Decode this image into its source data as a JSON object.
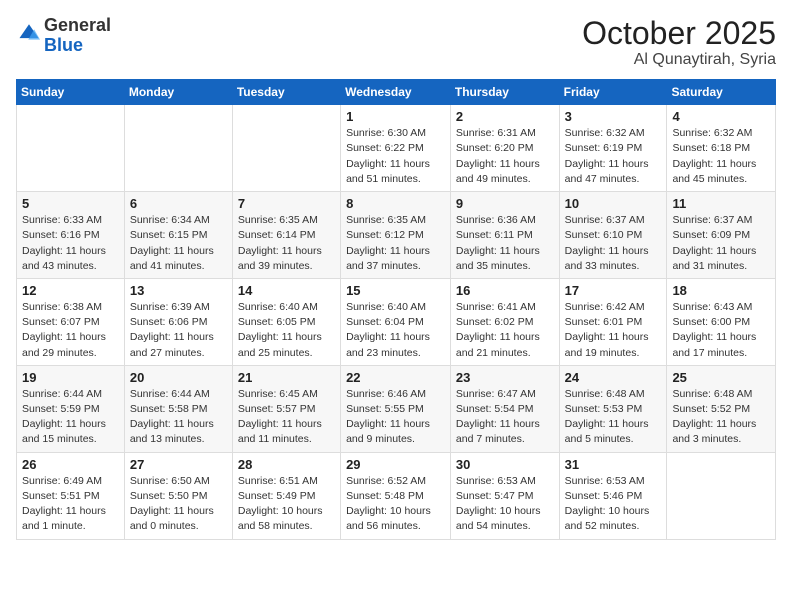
{
  "logo": {
    "general": "General",
    "blue": "Blue"
  },
  "header": {
    "month": "October 2025",
    "location": "Al Qunaytirah, Syria"
  },
  "days_of_week": [
    "Sunday",
    "Monday",
    "Tuesday",
    "Wednesday",
    "Thursday",
    "Friday",
    "Saturday"
  ],
  "weeks": [
    [
      {
        "day": "",
        "info": ""
      },
      {
        "day": "",
        "info": ""
      },
      {
        "day": "",
        "info": ""
      },
      {
        "day": "1",
        "info": "Sunrise: 6:30 AM\nSunset: 6:22 PM\nDaylight: 11 hours\nand 51 minutes."
      },
      {
        "day": "2",
        "info": "Sunrise: 6:31 AM\nSunset: 6:20 PM\nDaylight: 11 hours\nand 49 minutes."
      },
      {
        "day": "3",
        "info": "Sunrise: 6:32 AM\nSunset: 6:19 PM\nDaylight: 11 hours\nand 47 minutes."
      },
      {
        "day": "4",
        "info": "Sunrise: 6:32 AM\nSunset: 6:18 PM\nDaylight: 11 hours\nand 45 minutes."
      }
    ],
    [
      {
        "day": "5",
        "info": "Sunrise: 6:33 AM\nSunset: 6:16 PM\nDaylight: 11 hours\nand 43 minutes."
      },
      {
        "day": "6",
        "info": "Sunrise: 6:34 AM\nSunset: 6:15 PM\nDaylight: 11 hours\nand 41 minutes."
      },
      {
        "day": "7",
        "info": "Sunrise: 6:35 AM\nSunset: 6:14 PM\nDaylight: 11 hours\nand 39 minutes."
      },
      {
        "day": "8",
        "info": "Sunrise: 6:35 AM\nSunset: 6:12 PM\nDaylight: 11 hours\nand 37 minutes."
      },
      {
        "day": "9",
        "info": "Sunrise: 6:36 AM\nSunset: 6:11 PM\nDaylight: 11 hours\nand 35 minutes."
      },
      {
        "day": "10",
        "info": "Sunrise: 6:37 AM\nSunset: 6:10 PM\nDaylight: 11 hours\nand 33 minutes."
      },
      {
        "day": "11",
        "info": "Sunrise: 6:37 AM\nSunset: 6:09 PM\nDaylight: 11 hours\nand 31 minutes."
      }
    ],
    [
      {
        "day": "12",
        "info": "Sunrise: 6:38 AM\nSunset: 6:07 PM\nDaylight: 11 hours\nand 29 minutes."
      },
      {
        "day": "13",
        "info": "Sunrise: 6:39 AM\nSunset: 6:06 PM\nDaylight: 11 hours\nand 27 minutes."
      },
      {
        "day": "14",
        "info": "Sunrise: 6:40 AM\nSunset: 6:05 PM\nDaylight: 11 hours\nand 25 minutes."
      },
      {
        "day": "15",
        "info": "Sunrise: 6:40 AM\nSunset: 6:04 PM\nDaylight: 11 hours\nand 23 minutes."
      },
      {
        "day": "16",
        "info": "Sunrise: 6:41 AM\nSunset: 6:02 PM\nDaylight: 11 hours\nand 21 minutes."
      },
      {
        "day": "17",
        "info": "Sunrise: 6:42 AM\nSunset: 6:01 PM\nDaylight: 11 hours\nand 19 minutes."
      },
      {
        "day": "18",
        "info": "Sunrise: 6:43 AM\nSunset: 6:00 PM\nDaylight: 11 hours\nand 17 minutes."
      }
    ],
    [
      {
        "day": "19",
        "info": "Sunrise: 6:44 AM\nSunset: 5:59 PM\nDaylight: 11 hours\nand 15 minutes."
      },
      {
        "day": "20",
        "info": "Sunrise: 6:44 AM\nSunset: 5:58 PM\nDaylight: 11 hours\nand 13 minutes."
      },
      {
        "day": "21",
        "info": "Sunrise: 6:45 AM\nSunset: 5:57 PM\nDaylight: 11 hours\nand 11 minutes."
      },
      {
        "day": "22",
        "info": "Sunrise: 6:46 AM\nSunset: 5:55 PM\nDaylight: 11 hours\nand 9 minutes."
      },
      {
        "day": "23",
        "info": "Sunrise: 6:47 AM\nSunset: 5:54 PM\nDaylight: 11 hours\nand 7 minutes."
      },
      {
        "day": "24",
        "info": "Sunrise: 6:48 AM\nSunset: 5:53 PM\nDaylight: 11 hours\nand 5 minutes."
      },
      {
        "day": "25",
        "info": "Sunrise: 6:48 AM\nSunset: 5:52 PM\nDaylight: 11 hours\nand 3 minutes."
      }
    ],
    [
      {
        "day": "26",
        "info": "Sunrise: 6:49 AM\nSunset: 5:51 PM\nDaylight: 11 hours\nand 1 minute."
      },
      {
        "day": "27",
        "info": "Sunrise: 6:50 AM\nSunset: 5:50 PM\nDaylight: 11 hours\nand 0 minutes."
      },
      {
        "day": "28",
        "info": "Sunrise: 6:51 AM\nSunset: 5:49 PM\nDaylight: 10 hours\nand 58 minutes."
      },
      {
        "day": "29",
        "info": "Sunrise: 6:52 AM\nSunset: 5:48 PM\nDaylight: 10 hours\nand 56 minutes."
      },
      {
        "day": "30",
        "info": "Sunrise: 6:53 AM\nSunset: 5:47 PM\nDaylight: 10 hours\nand 54 minutes."
      },
      {
        "day": "31",
        "info": "Sunrise: 6:53 AM\nSunset: 5:46 PM\nDaylight: 10 hours\nand 52 minutes."
      },
      {
        "day": "",
        "info": ""
      }
    ]
  ]
}
